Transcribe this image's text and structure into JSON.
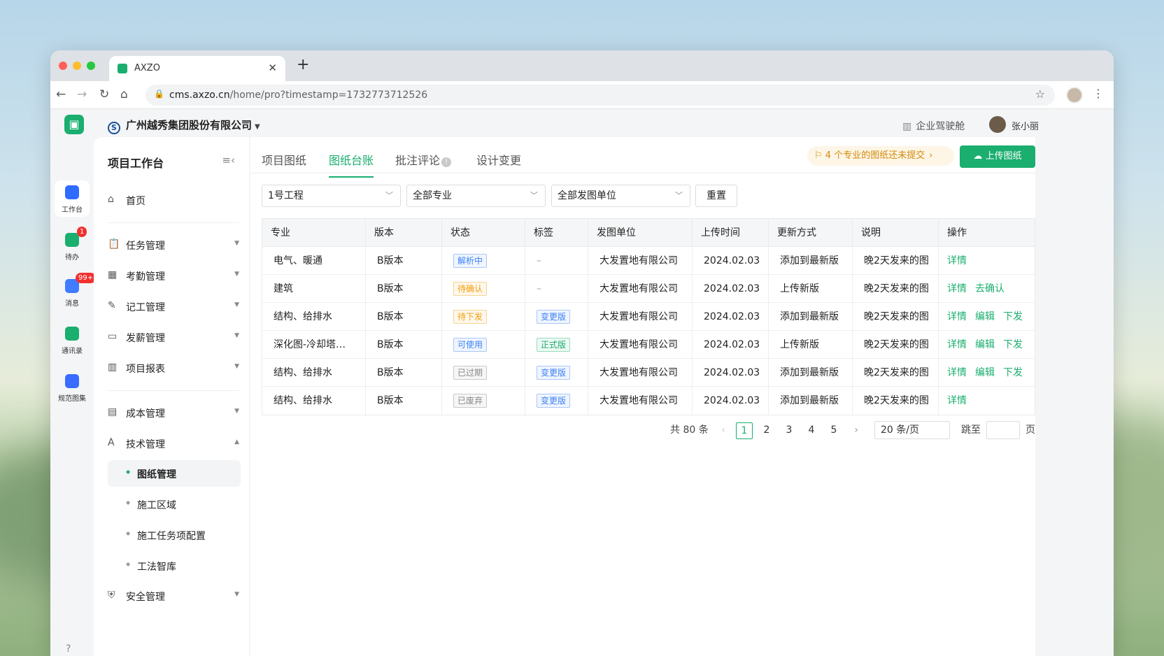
{
  "colors": {
    "accent": "#1aae6f",
    "warning": "#d48a0a",
    "danger": "#f23030"
  },
  "browser": {
    "tab_title": "AXZO",
    "url_domain": "cms.axzo.cn",
    "url_path": "/home/pro?timestamp=1732773712526"
  },
  "header": {
    "company": "广州越秀集团股份有限公司",
    "cockpit": "企业驾驶舱",
    "user": "张小丽"
  },
  "rail": [
    {
      "label": "工作台",
      "icon": "grid-icon",
      "color": "#2f6bff"
    },
    {
      "label": "待办",
      "icon": "calendar-check-icon",
      "color": "#1aae6f",
      "badge": "1"
    },
    {
      "label": "消息",
      "icon": "chat-icon",
      "color": "#3f7cff",
      "badge": "99+"
    },
    {
      "label": "通讯录",
      "icon": "phone-book-icon",
      "color": "#1aae6f"
    },
    {
      "label": "规范图集",
      "icon": "book-icon",
      "color": "#3a6bff"
    }
  ],
  "sidebar": {
    "title": "项目工作台",
    "home": "首页",
    "menu": [
      "任务管理",
      "考勤管理",
      "记工管理",
      "发薪管理",
      "项目报表",
      "成本管理",
      "技术管理"
    ],
    "sub": [
      "图纸管理",
      "施工区域",
      "施工任务项配置",
      "工法智库"
    ],
    "safety": "安全管理"
  },
  "tabs": [
    "项目图纸",
    "图纸台账",
    "批注评论",
    "设计变更"
  ],
  "notice": "4 个专业的图纸还未提交",
  "upload": "上传图纸",
  "filters": {
    "project": "1号工程",
    "discipline": "全部专业",
    "unit": "全部发图单位",
    "reset": "重置"
  },
  "table": {
    "headers": [
      "专业",
      "版本",
      "状态",
      "标签",
      "发图单位",
      "上传时间",
      "更新方式",
      "说明",
      "操作"
    ],
    "rows": [
      {
        "discipline": "电气、暖通",
        "version": "B版本",
        "status": "解析中",
        "status_color": "#3b82f6",
        "tag": "–",
        "tag_color": "",
        "unit": "大发置地有限公司",
        "time": "2024.02.03",
        "method": "添加到最新版",
        "note": "晚2天发来的图",
        "ops": [
          "详情"
        ]
      },
      {
        "discipline": "建筑",
        "version": "B版本",
        "status": "待确认",
        "status_color": "#f59e0b",
        "tag": "–",
        "tag_color": "",
        "unit": "大发置地有限公司",
        "time": "2024.02.03",
        "method": "上传新版",
        "note": "晚2天发来的图",
        "ops": [
          "详情",
          "去确认"
        ]
      },
      {
        "discipline": "结构、给排水",
        "version": "B版本",
        "status": "待下发",
        "status_color": "#f59e0b",
        "tag": "变更版",
        "tag_color": "#3b82f6",
        "unit": "大发置地有限公司",
        "time": "2024.02.03",
        "method": "添加到最新版",
        "note": "晚2天发来的图",
        "ops": [
          "详情",
          "编辑",
          "下发"
        ]
      },
      {
        "discipline": "深化图-冷却塔…",
        "version": "B版本",
        "status": "可使用",
        "status_color": "#3b82f6",
        "tag": "正式版",
        "tag_color": "#1aae6f",
        "unit": "大发置地有限公司",
        "time": "2024.02.03",
        "method": "上传新版",
        "note": "晚2天发来的图",
        "ops": [
          "详情",
          "编辑",
          "下发"
        ]
      },
      {
        "discipline": "结构、给排水",
        "version": "B版本",
        "status": "已过期",
        "status_color": "#888888",
        "tag": "变更版",
        "tag_color": "#3b82f6",
        "unit": "大发置地有限公司",
        "time": "2024.02.03",
        "method": "添加到最新版",
        "note": "晚2天发来的图",
        "ops": [
          "详情",
          "编辑",
          "下发"
        ]
      },
      {
        "discipline": "结构、给排水",
        "version": "B版本",
        "status": "已废弃",
        "status_color": "#888888",
        "tag": "变更版",
        "tag_color": "#3b82f6",
        "unit": "大发置地有限公司",
        "time": "2024.02.03",
        "method": "添加到最新版",
        "note": "晚2天发来的图",
        "ops": [
          "详情"
        ]
      }
    ]
  },
  "pagination": {
    "total": "共 80 条",
    "pages": [
      "1",
      "2",
      "3",
      "4",
      "5"
    ],
    "current": "1",
    "page_size": "20 条/页",
    "jump_label": "跳至",
    "page_unit": "页"
  }
}
